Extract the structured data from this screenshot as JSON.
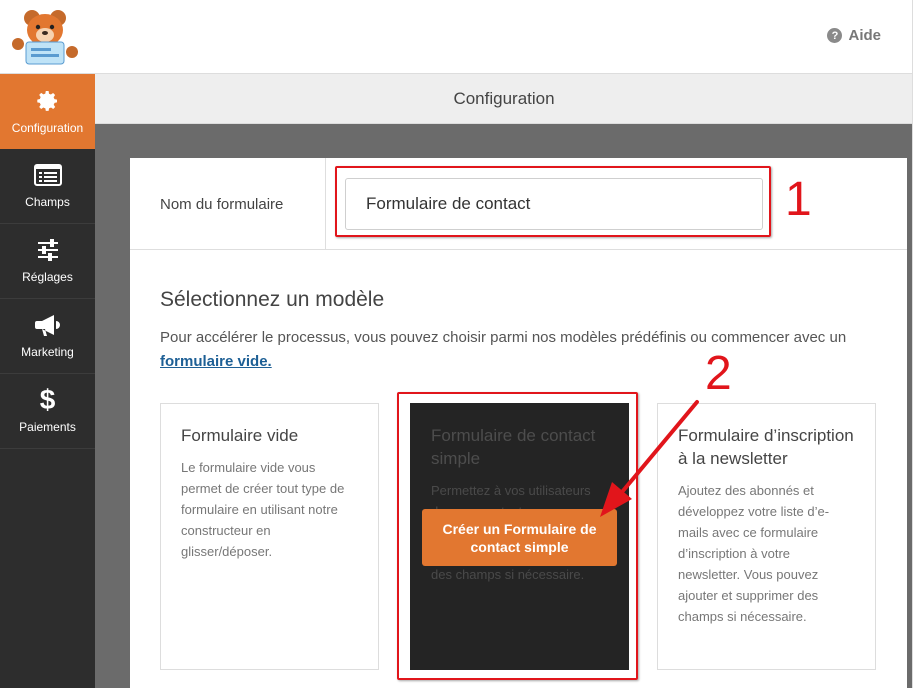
{
  "topbar": {
    "help_label": "Aide",
    "help_icon": "question-circle-icon"
  },
  "sidebar": {
    "items": [
      {
        "label": "Configuration",
        "icon": "gear-icon",
        "active": true
      },
      {
        "label": "Champs",
        "icon": "list-icon",
        "active": false
      },
      {
        "label": "Réglages",
        "icon": "sliders-icon",
        "active": false
      },
      {
        "label": "Marketing",
        "icon": "megaphone-icon",
        "active": false
      },
      {
        "label": "Paiements",
        "icon": "dollar-icon",
        "active": false
      }
    ]
  },
  "header": {
    "title": "Configuration"
  },
  "form_name": {
    "label": "Nom du formulaire",
    "value": "Formulaire de contact"
  },
  "templates": {
    "title": "Sélectionnez un modèle",
    "description": "Pour accélérer le processus, vous pouvez choisir parmi nos modèles prédéfinis ou commencer avec un",
    "link": "formulaire vide.",
    "cards": [
      {
        "title": "Formulaire vide",
        "description": "Le formulaire vide vous permet de créer tout type de formulaire en utilisant notre constructeur en glisser/déposer."
      },
      {
        "title": "Formulaire de contact simple",
        "description": "Permettez à vos utilisateurs de vous contacter avec ce formulaire simple. Vous pouvez ajouter et supprimer des champs si nécessaire.",
        "button": "Créer un Formulaire de contact simple"
      },
      {
        "title": "Formulaire d’inscription à la newsletter",
        "description": "Ajoutez des abonnés et développez votre liste d’e-mails avec ce formulaire d’inscription à votre newsletter. Vous pouvez ajouter et supprimer des champs si nécessaire."
      }
    ]
  },
  "annotations": {
    "step1": "1",
    "step2": "2",
    "color": "#e1151b"
  },
  "colors": {
    "accent": "#e27730",
    "sidebar": "#2d2d2d"
  }
}
